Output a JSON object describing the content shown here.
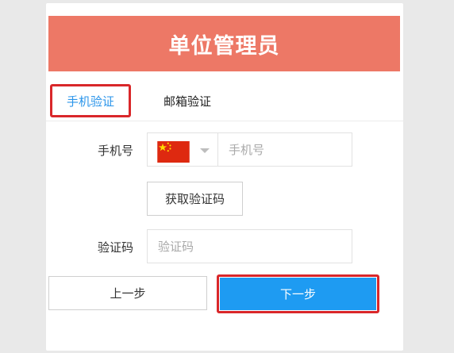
{
  "header": {
    "title": "单位管理员",
    "color": "#ed7866"
  },
  "tabs": [
    {
      "label": "手机验证",
      "active": true
    },
    {
      "label": "邮箱验证",
      "active": false
    }
  ],
  "form": {
    "phone_label": "手机号",
    "phone_placeholder": "手机号",
    "country_flag": "china-flag-icon",
    "get_code_label": "获取验证码",
    "code_label": "验证码",
    "code_placeholder": "验证码"
  },
  "actions": {
    "prev_label": "上一步",
    "next_label": "下一步",
    "next_color": "#1e9bf2"
  },
  "colors": {
    "highlight_border": "#d9272a",
    "active_tab": "#2b95ea"
  }
}
